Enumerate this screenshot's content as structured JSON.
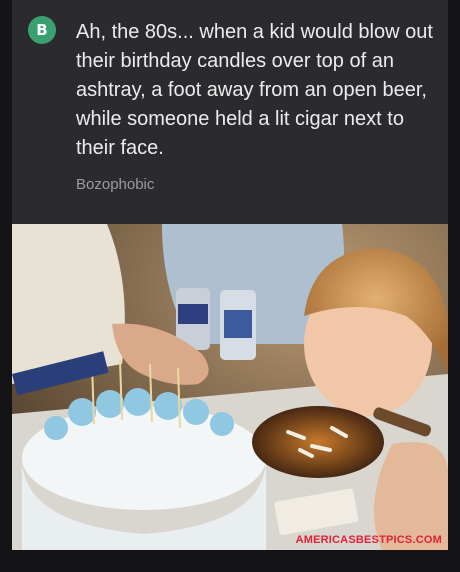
{
  "post": {
    "avatar_letter": "B",
    "avatar_color": "#3aa070",
    "text": "Ah, the 80s... when a kid would blow out their birthday candles over top of an ashtray, a foot away from an open beer, while someone held a lit cigar next to their face.",
    "username": "Bozophobic"
  },
  "watermark": "AMERICASBESTPICS.COM"
}
